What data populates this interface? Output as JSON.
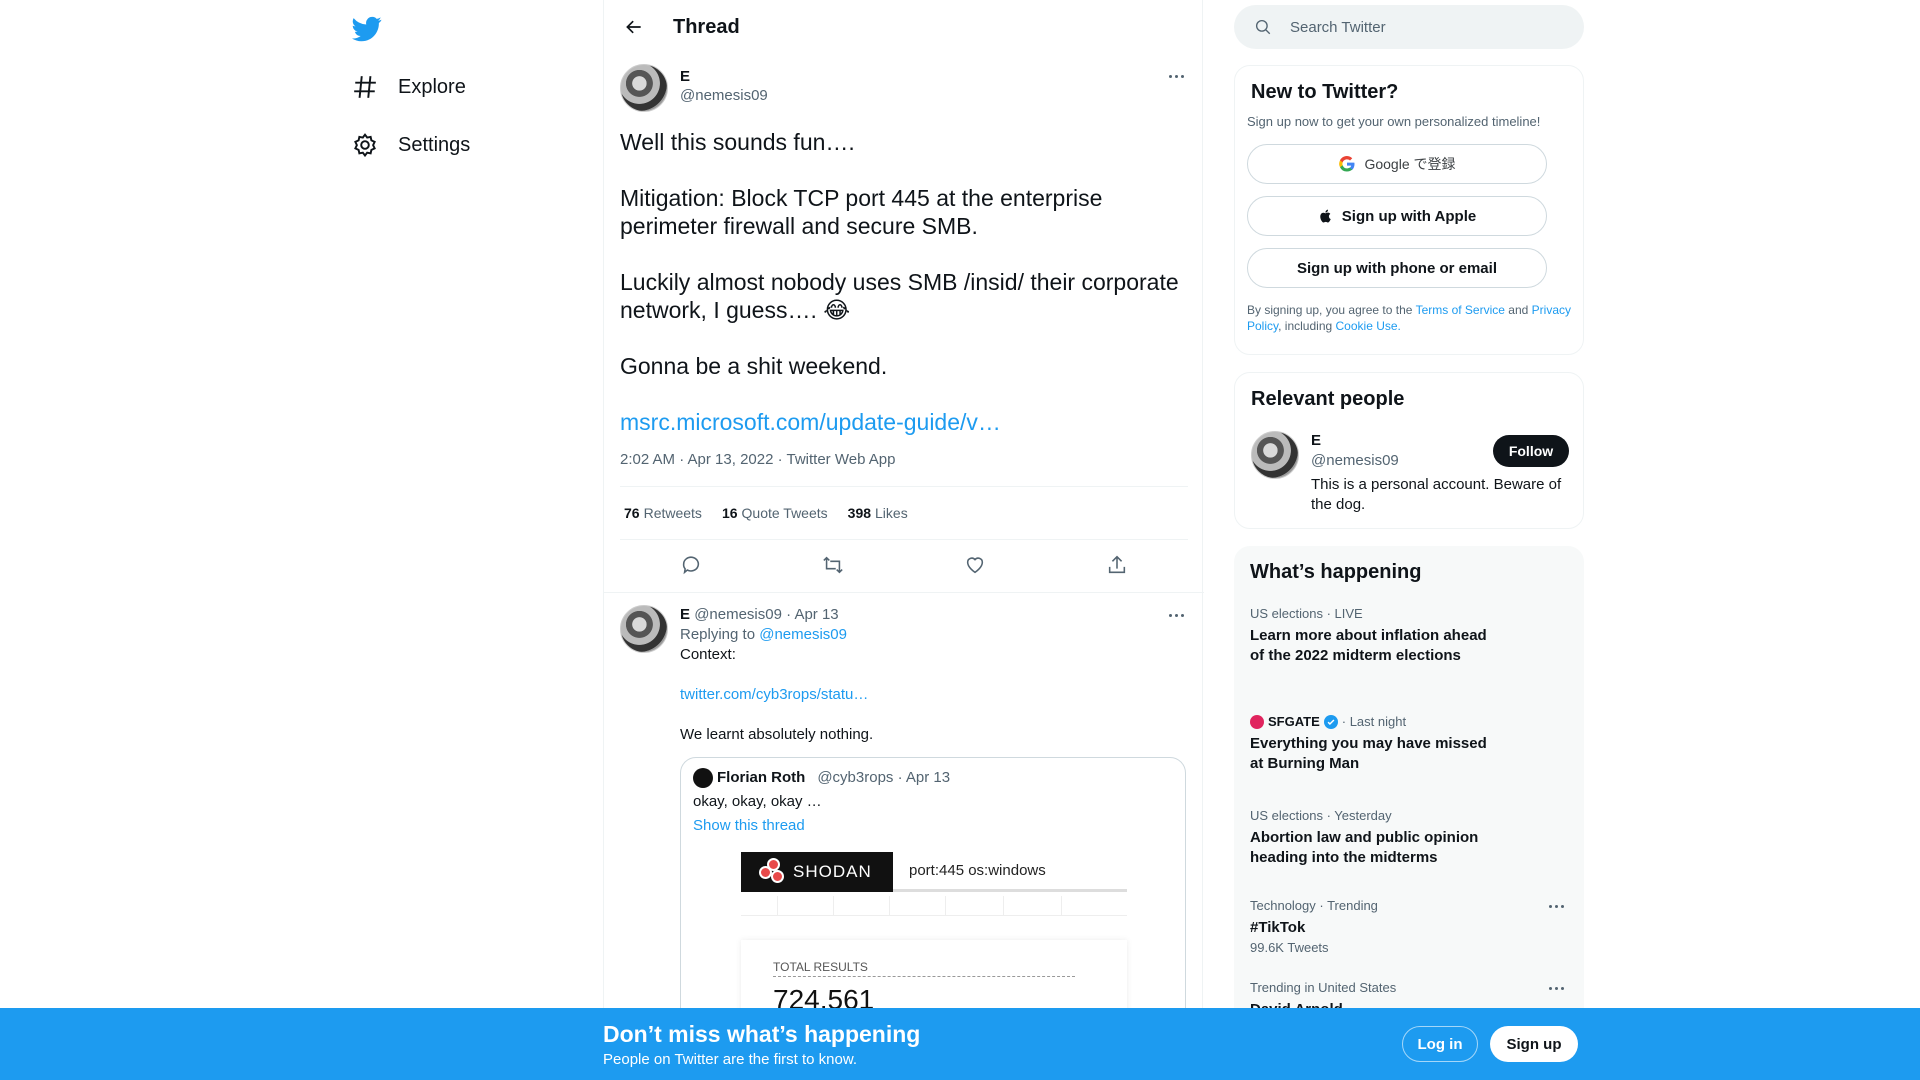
{
  "nav": {
    "explore": "Explore",
    "settings": "Settings"
  },
  "header": {
    "title": "Thread"
  },
  "main_tweet": {
    "name": "E",
    "handle": "@nemesis09",
    "paragraphs": [
      "Well this sounds fun….",
      "Mitigation: Block TCP port 445 at the enterprise perimeter firewall and secure SMB.",
      "Luckily almost nobody uses SMB /insid/  their corporate network, I guess…. 😂",
      "Gonna be a shit weekend."
    ],
    "link": "msrc.microsoft.com/update-guide/v…",
    "meta": "2:02 AM · Apr 13, 2022 · Twitter Web App",
    "retweets_count": "76",
    "retweets_label": "Retweets",
    "quotes_count": "16",
    "quotes_label": "Quote Tweets",
    "likes_count": "398",
    "likes_label": "Likes"
  },
  "reply": {
    "name": "E",
    "meta": "@nemesis09 · Apr 13",
    "replying_prefix": "Replying to",
    "replying_handle": "@nemesis09",
    "context": "Context:",
    "link": "twitter.com/cyb3rops/statu…",
    "closing": "We learnt absolutely nothing.",
    "quote": {
      "name": "Florian Roth",
      "meta": "@cyb3rops · Apr 13",
      "text": "okay, okay, okay …",
      "show_thread": "Show this thread",
      "image_brand": "SHODAN",
      "image_query": "port:445 os:windows",
      "image_result_label": "TOTAL RESULTS",
      "image_result_value": "724,561"
    }
  },
  "search": {
    "placeholder": "Search Twitter"
  },
  "new_to_twitter": {
    "title": "New to Twitter?",
    "subtitle": "Sign up now to get your own personalized timeline!",
    "google": "Google で登録",
    "apple": "Sign up with Apple",
    "phone": "Sign up with phone or email",
    "terms_pre": "By signing up, you agree to the",
    "terms_link": "Terms of Service",
    "terms_and": "and",
    "privacy_link": "Privacy Policy",
    "terms_including": ", including",
    "cookie_link": "Cookie Use."
  },
  "relevant_people": {
    "title": "Relevant people",
    "name": "E",
    "handle": "@nemesis09",
    "bio": "This is a personal account. Beware of the dog.",
    "follow": "Follow"
  },
  "happening": {
    "title": "What’s happening",
    "trends": [
      {
        "meta": "US elections · LIVE",
        "title": "Learn more about inflation ahead of the 2022 midterm elections"
      },
      {
        "source": "SFGATE",
        "meta": "· Last night",
        "title": "Everything you may have missed at Burning Man"
      },
      {
        "meta": "US elections · Yesterday",
        "title": "Abortion law and public opinion heading into the midterms"
      },
      {
        "meta": "Technology · Trending",
        "title": "#TikTok",
        "count": "99.6K Tweets"
      },
      {
        "meta": "Trending in United States",
        "title": "David Arnold"
      }
    ]
  },
  "bottom_bar": {
    "title": "Don’t miss what’s happening",
    "subtitle": "People on Twitter are the first to know.",
    "login": "Log in",
    "signup": "Sign up"
  },
  "colors": {
    "accent": "#1d9bf0",
    "text": "#0f1419",
    "muted": "#536471"
  }
}
